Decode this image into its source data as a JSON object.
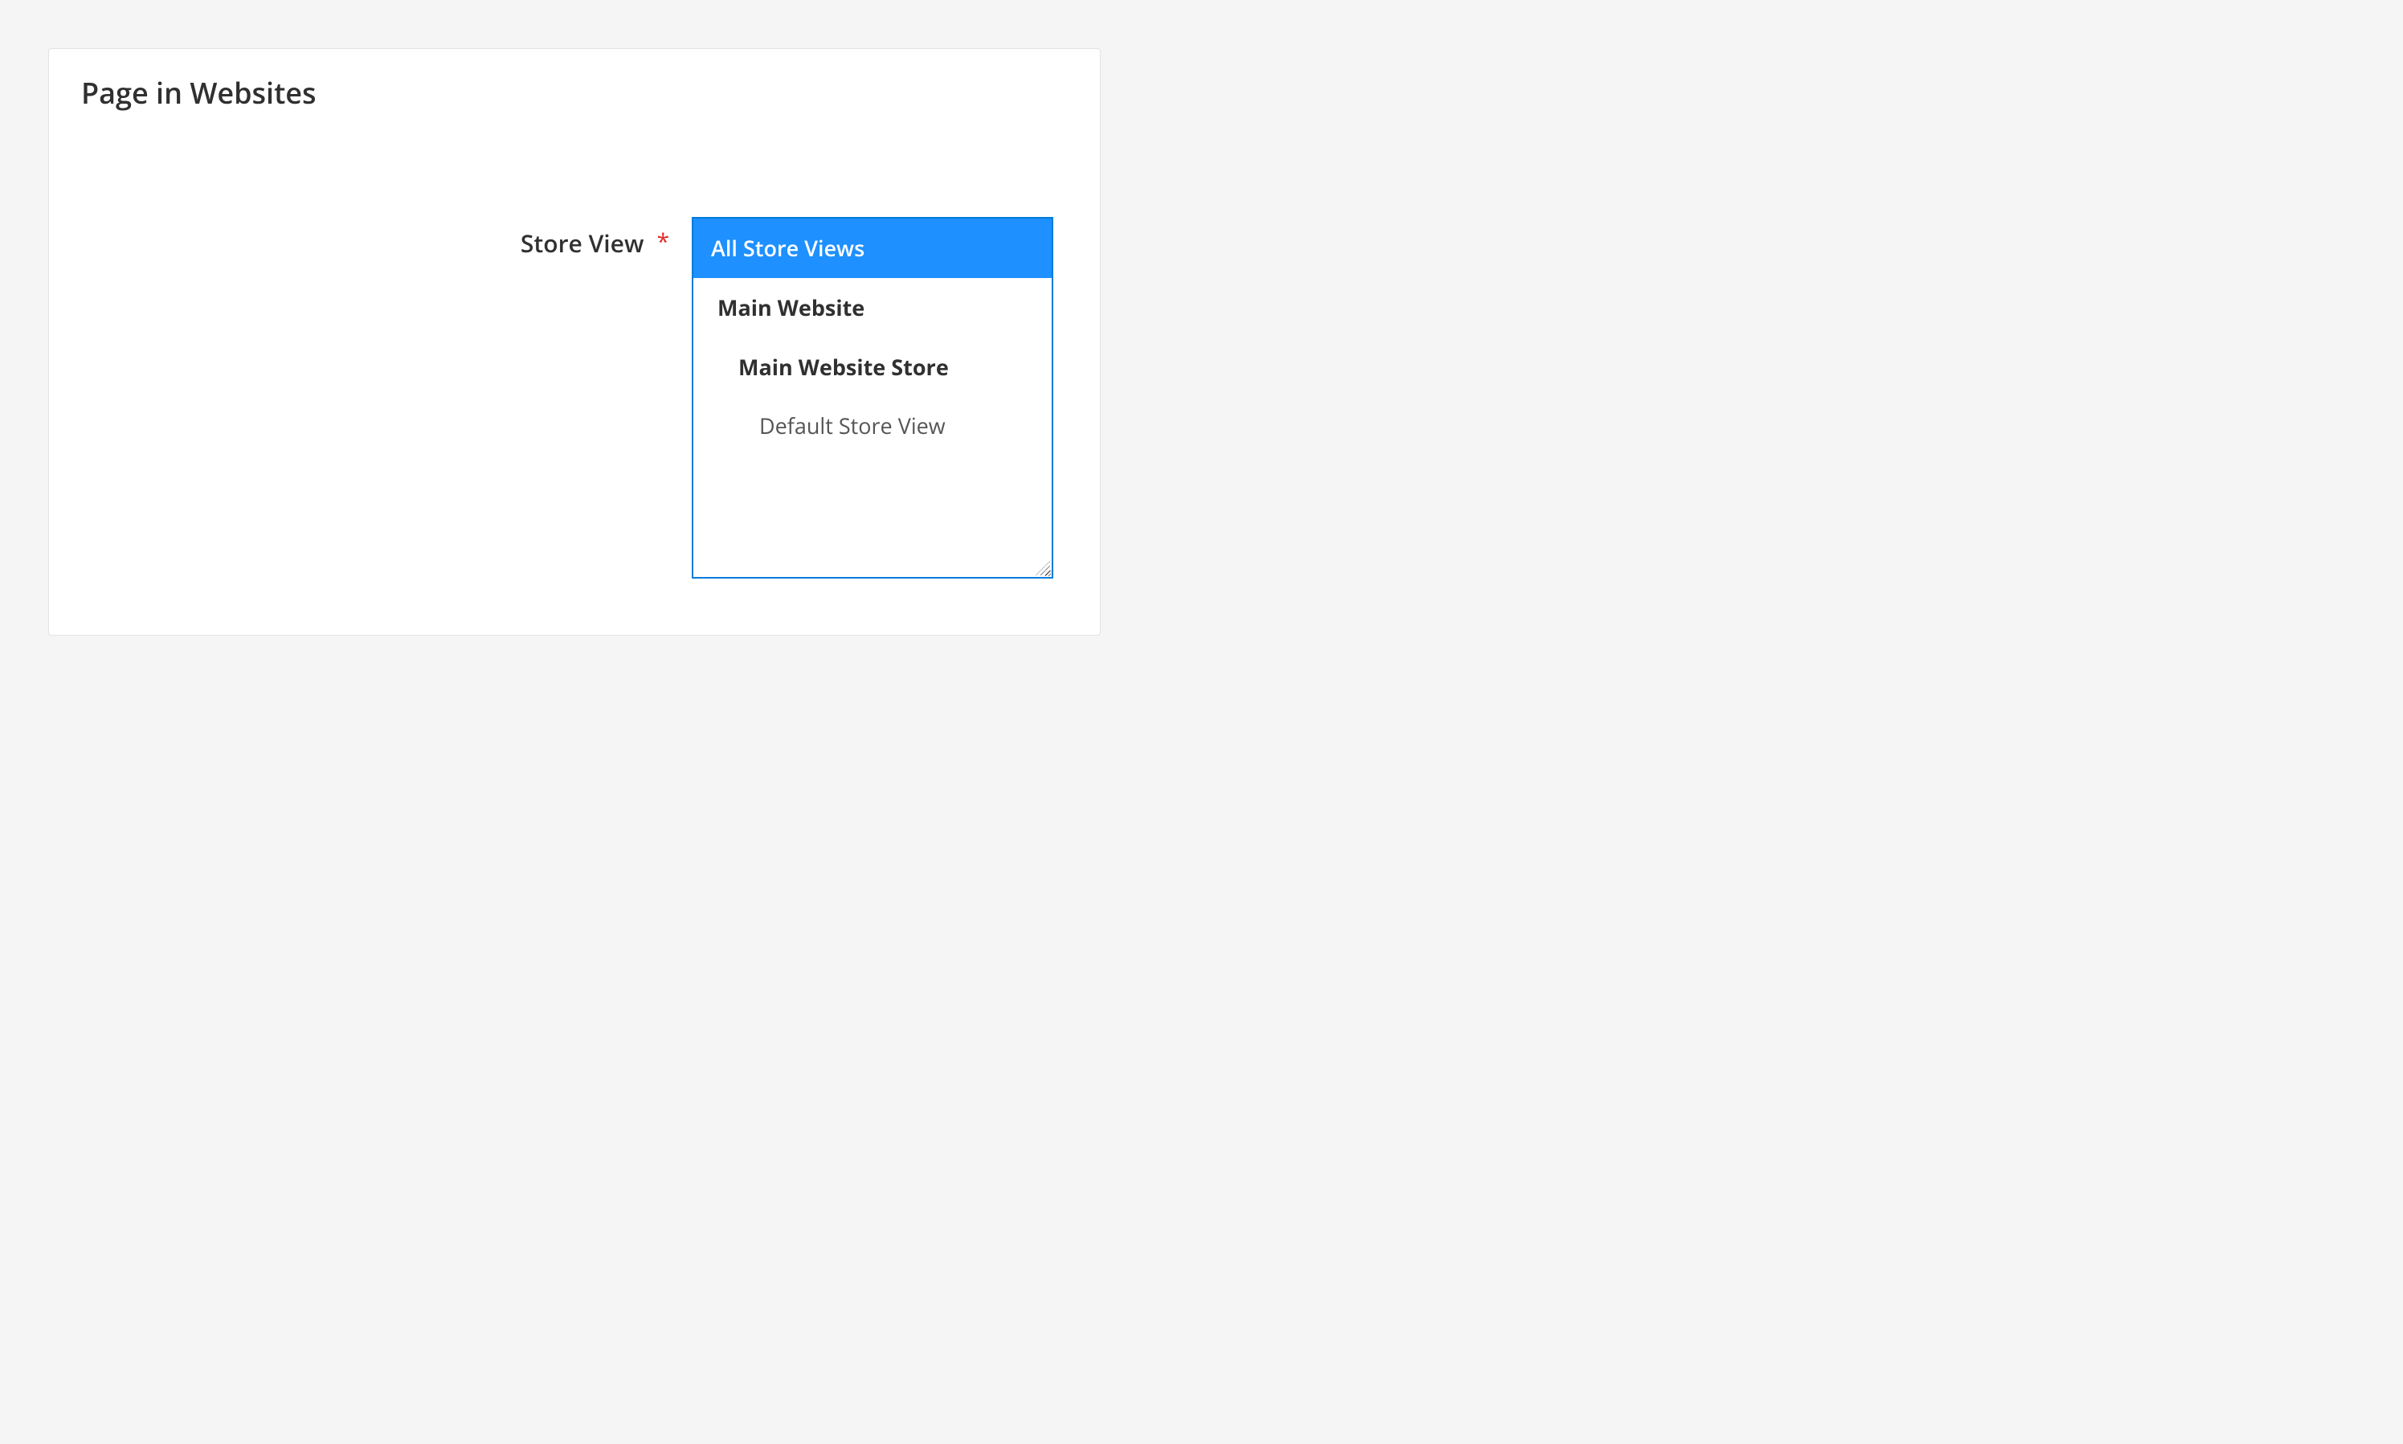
{
  "panel": {
    "title": "Page in Websites"
  },
  "field": {
    "label": "Store View",
    "required_marker": "*",
    "options": [
      {
        "label": "All Store Views",
        "level": 0,
        "selected": true
      },
      {
        "label": "Main Website",
        "level": 1,
        "selected": false
      },
      {
        "label": "Main Website Store",
        "level": 2,
        "selected": false
      },
      {
        "label": "Default Store View",
        "level": 3,
        "selected": false
      }
    ]
  }
}
